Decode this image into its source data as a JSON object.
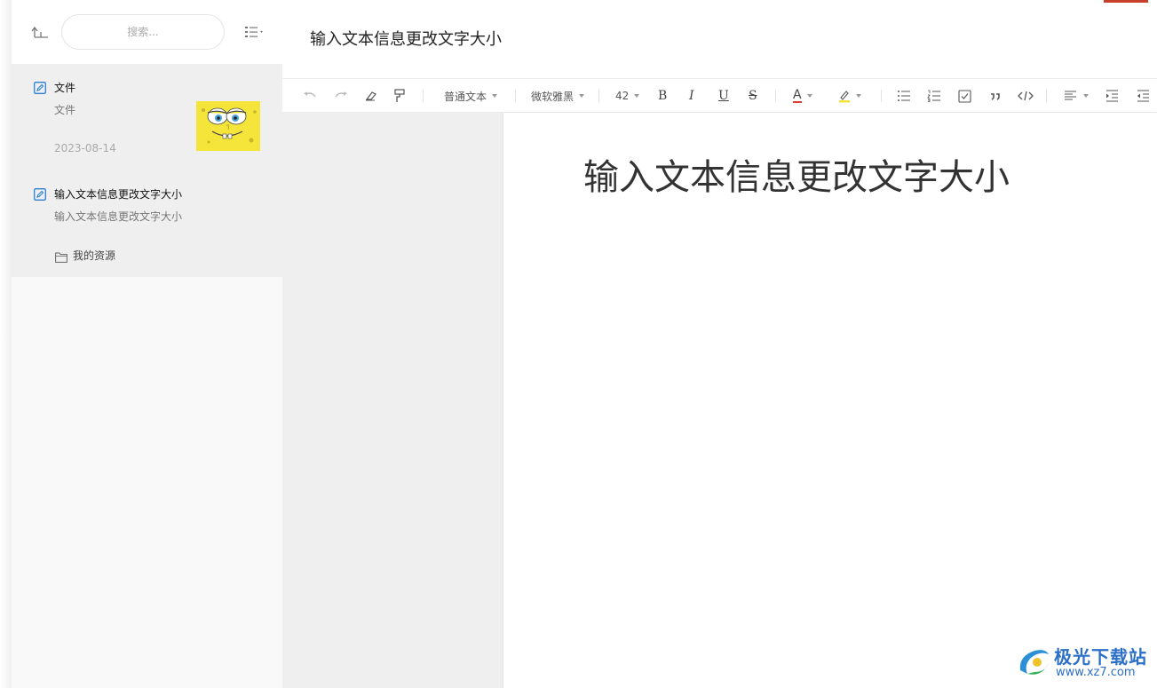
{
  "sidebar": {
    "search": {
      "placeholder": "搜索..."
    },
    "notes": [
      {
        "title": "文件",
        "summary": "文件",
        "date": "2023-08-14",
        "has_thumbnail": true
      },
      {
        "title": "输入文本信息更改文字大小",
        "summary": "输入文本信息更改文字大小"
      }
    ],
    "folder": {
      "label": "我的资源"
    }
  },
  "editor": {
    "title": "输入文本信息更改文字大小",
    "toolbar": {
      "paragraph_style": "普通文本",
      "font_family": "微软雅黑",
      "font_size": "42",
      "bold_label": "B",
      "italic_label": "I",
      "underline_label": "U",
      "strike_label": "S",
      "font_color_label": "A",
      "font_color": "#e03b2f",
      "highlight_color": "#f5e23b"
    },
    "body_text": "输入文本信息更改文字大小"
  },
  "watermark": {
    "name": "极光下载站",
    "url": "www.xz7.com"
  },
  "colors": {
    "accent": "#2d7fd3",
    "watermark": "#2c6fc7"
  }
}
